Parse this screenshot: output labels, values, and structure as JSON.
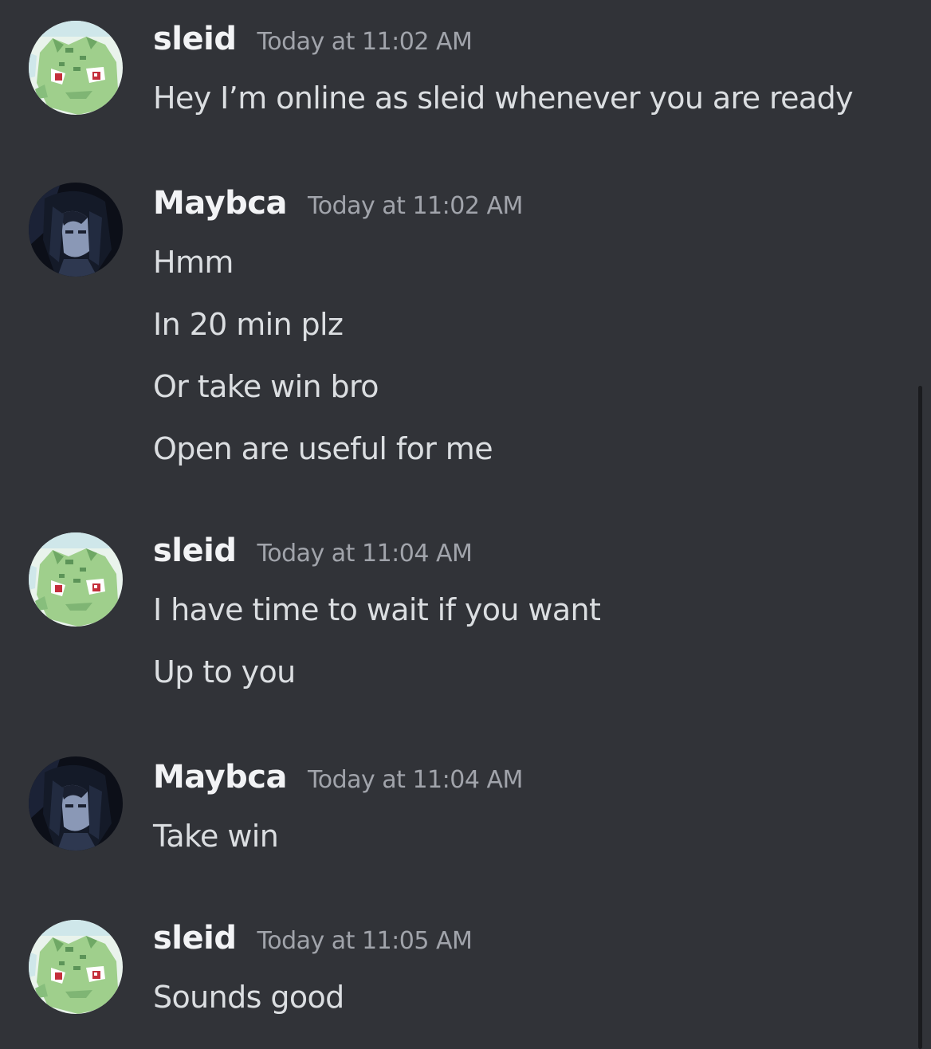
{
  "messages": [
    {
      "author": "sleid",
      "timestamp": "Today at 11:02 AM",
      "lines": [
        "Hey I’m online as sleid whenever you are ready"
      ]
    },
    {
      "author": "Maybca",
      "timestamp": "Today at 11:02 AM",
      "lines": [
        "Hmm",
        "In 20 min plz",
        "Or take win bro",
        "Open are useful for me"
      ]
    },
    {
      "author": "sleid",
      "timestamp": "Today at 11:04 AM",
      "lines": [
        "I have time to wait if you want",
        "Up to you"
      ]
    },
    {
      "author": "Maybca",
      "timestamp": "Today at 11:04 AM",
      "lines": [
        "Take win"
      ]
    },
    {
      "author": "sleid",
      "timestamp": "Today at 11:05 AM",
      "lines": [
        "Sounds good"
      ]
    }
  ],
  "colors": {
    "background": "#313338",
    "username": "#f2f3f5",
    "timestamp": "#a1a4ab",
    "message_text": "#dbdee1"
  },
  "icons": {
    "sleid_avatar": "bulbasaur-pixel-avatar",
    "maybca_avatar": "dark-haired-anime-character-avatar"
  }
}
